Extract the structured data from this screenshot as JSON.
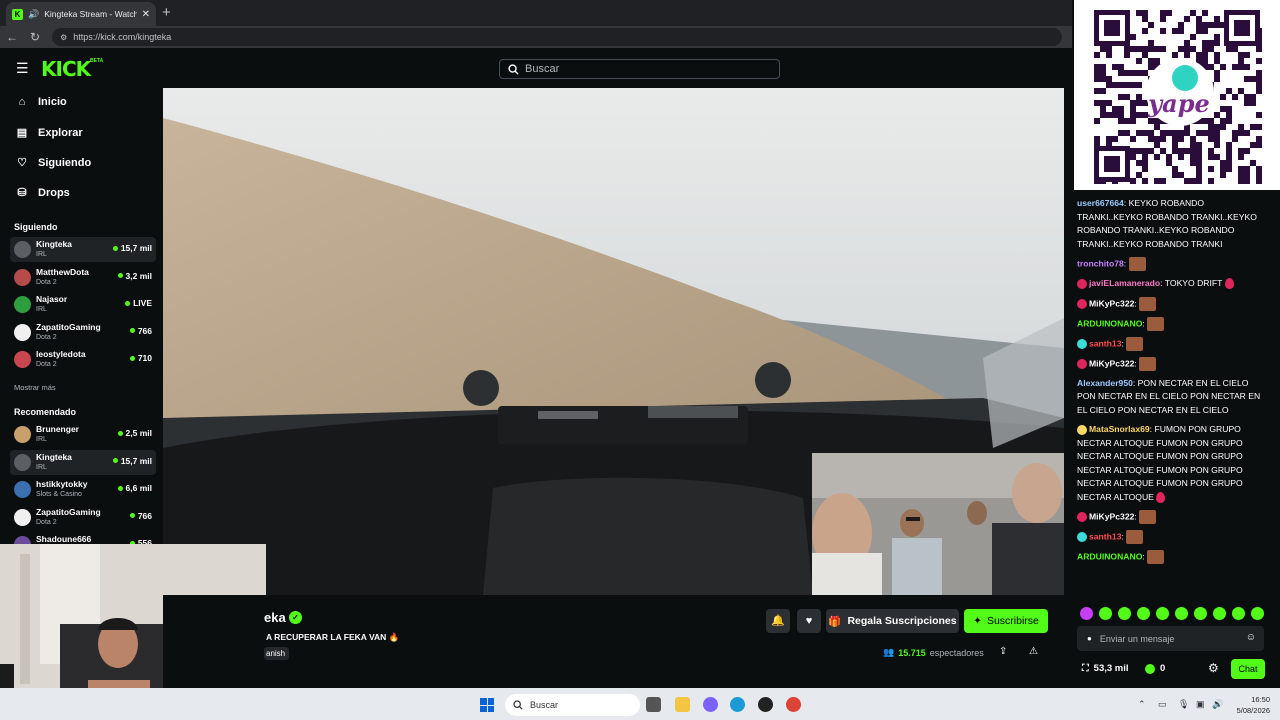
{
  "browser": {
    "tab_title": "Kingteka Stream - Watch Live",
    "url": "https://kick.com/kingteka",
    "new_tab": "+"
  },
  "header": {
    "logo": "KICK",
    "beta": "BETA",
    "search_placeholder": "Buscar"
  },
  "sidebar": {
    "nav": [
      {
        "label": "Inicio",
        "icon": "home-icon"
      },
      {
        "label": "Explorar",
        "icon": "compass-icon"
      },
      {
        "label": "Siguiendo",
        "icon": "heart-icon"
      },
      {
        "label": "Drops",
        "icon": "gift-icon"
      }
    ],
    "following_title": "Siguiendo",
    "following": [
      {
        "name": "Kingteka",
        "category": "IRL",
        "viewers": "15,7 mil",
        "avatar_color": "#5b5f63"
      },
      {
        "name": "MatthewDota",
        "category": "Dota 2",
        "viewers": "3,2 mil",
        "avatar_color": "#b54b4b"
      },
      {
        "name": "Najasor",
        "category": "IRL",
        "viewers": "LIVE",
        "avatar_color": "#2f9c3d"
      },
      {
        "name": "ZapatitoGaming",
        "category": "Dota 2",
        "viewers": "766",
        "avatar_color": "#f0f0f0"
      },
      {
        "name": "leostyledota",
        "category": "Dota 2",
        "viewers": "710",
        "avatar_color": "#c8474f"
      }
    ],
    "show_more": "Mostrar más",
    "recommended_title": "Recomendado",
    "recommended": [
      {
        "name": "Brunenger",
        "category": "IRL",
        "viewers": "2,5 mil",
        "avatar_color": "#c9a06b"
      },
      {
        "name": "Kingteka",
        "category": "IRL",
        "viewers": "15,7 mil",
        "avatar_color": "#5b5f63"
      },
      {
        "name": "hstikkytokky",
        "category": "Slots & Casino",
        "viewers": "6,6 mil",
        "avatar_color": "#3b6fb0"
      },
      {
        "name": "ZapatitoGaming",
        "category": "Dota 2",
        "viewers": "766",
        "avatar_color": "#f0f0f0"
      },
      {
        "name": "Shadoune666",
        "category": "",
        "viewers": "556",
        "avatar_color": "#6a4b9c"
      }
    ]
  },
  "stream": {
    "name": "eka",
    "title": "A RECUPERAR LA FEKA VAN",
    "language": "anish",
    "gift_label": "Regala Suscripciones",
    "subscribe_label": "Suscribirse",
    "viewers": "15.715",
    "viewers_label": "espectadores"
  },
  "chat": {
    "messages": [
      {
        "user": "user667664",
        "color": "#9ecbff",
        "badges": [],
        "text": ": KEYKO ROBANDO TRANKI..KEYKO ROBANDO TRANKI..KEYKO ROBANDO TRANKI..KEYKO ROBANDO TRANKI..KEYKO ROBANDO TRANKI",
        "emote": false,
        "drops": 0
      },
      {
        "user": "tronchito78",
        "color": "#c77dff",
        "badges": [],
        "text": ":",
        "emote": true,
        "drops": 0
      },
      {
        "user": "javiELamanerado",
        "color": "#ff79c6",
        "badges": [
          "#e0245e"
        ],
        "text": ": TOKYO DRIFT",
        "emote": false,
        "drops": 1
      },
      {
        "user": "MiKyPc322",
        "color": "#ffffff",
        "badges": [
          "#e0245e"
        ],
        "text": ":",
        "emote": true,
        "drops": 0
      },
      {
        "user": "ARDUINONANO",
        "color": "#53fc18",
        "badges": [],
        "text": ":",
        "emote": true,
        "drops": 0
      },
      {
        "user": "santh13",
        "color": "#ff4d4d",
        "badges": [
          "#3ddbd9"
        ],
        "text": ":",
        "emote": true,
        "drops": 0
      },
      {
        "user": "MiKyPc322",
        "color": "#ffffff",
        "badges": [
          "#e0245e"
        ],
        "text": ":",
        "emote": true,
        "drops": 0
      },
      {
        "user": "Alexander950",
        "color": "#9ecbff",
        "badges": [],
        "text": ": PON NECTAR EN EL CIELO PON NECTAR EN EL CIELO PON NECTAR EN EL CIELO PON NECTAR EN EL CIELO",
        "emote": false,
        "drops": 0
      },
      {
        "user": "MataSnorlax69",
        "color": "#ffd866",
        "badges": [
          "#ffd866"
        ],
        "text": ": FUMON PON GRUPO NECTAR ALTOQUE  FUMON PON GRUPO NECTAR ALTOQUE  FUMON PON GRUPO NECTAR ALTOQUE  FUMON PON GRUPO NECTAR ALTOQUE  FUMON PON GRUPO NECTAR ALTOQUE",
        "emote": false,
        "drops": 1
      },
      {
        "user": "MiKyPc322",
        "color": "#ffffff",
        "badges": [
          "#e0245e"
        ],
        "text": ":",
        "emote": true,
        "drops": 0
      },
      {
        "user": "santh13",
        "color": "#ff4d4d",
        "badges": [
          "#3ddbd9"
        ],
        "text": ":",
        "emote": true,
        "drops": 0
      },
      {
        "user": "ARDUINONANO",
        "color": "#53fc18",
        "badges": [],
        "text": ":",
        "emote": true,
        "drops": 0
      }
    ],
    "input_placeholder": "Enviar un mensaje",
    "points": "53,3 mil",
    "kicks": "0",
    "chat_button": "Chat"
  },
  "taskbar": {
    "search_placeholder": "Buscar",
    "time": "16:50",
    "date": "5/08/2026"
  },
  "colors": {
    "accent": "#53fc18",
    "bg": "#0b0e0f"
  }
}
